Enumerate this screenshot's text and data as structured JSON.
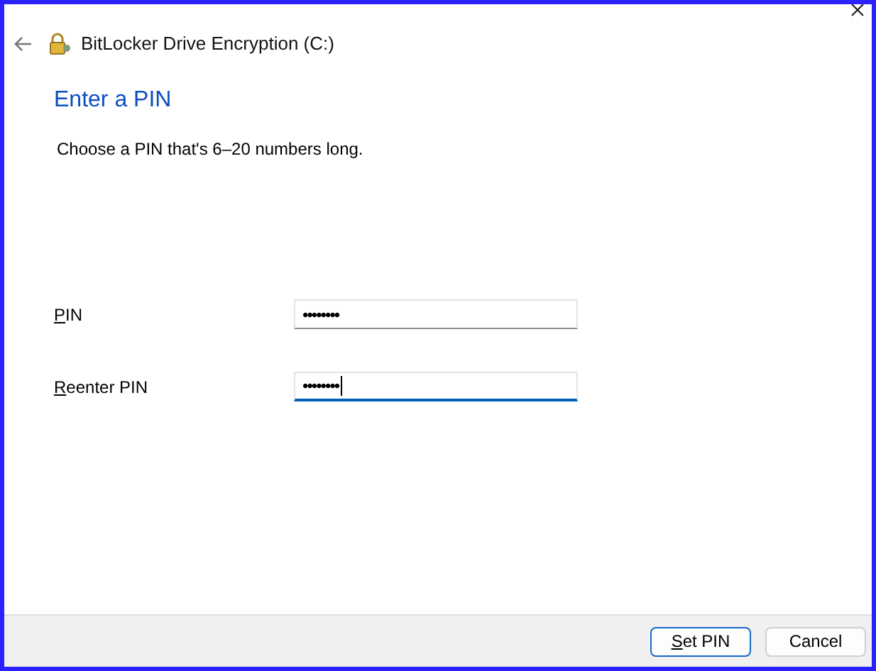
{
  "window": {
    "title": "BitLocker Drive Encryption (C:)"
  },
  "heading": "Enter a PIN",
  "description": "Choose a PIN that's 6–20 numbers long.",
  "fields": [
    {
      "label": "PIN",
      "underline_first": true,
      "value": "••••••••",
      "focused": false
    },
    {
      "label": "Reenter PIN",
      "underline_first": true,
      "value": "••••••••",
      "focused": true
    }
  ],
  "buttons": [
    {
      "label": "Set PIN",
      "underline_first": true,
      "default": true
    },
    {
      "label": "Cancel",
      "underline_first": false,
      "default": false
    }
  ]
}
